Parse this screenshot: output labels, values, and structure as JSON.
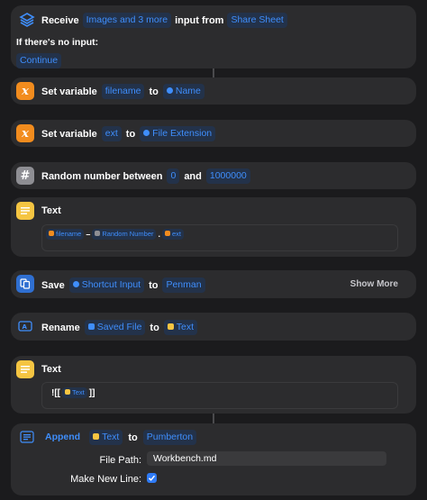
{
  "receive": {
    "label": "Receive",
    "types_token": "Images and 3 more",
    "mid_text": "input from",
    "source_token": "Share Sheet",
    "no_input_label": "If there's no input:",
    "continue_token": "Continue"
  },
  "set_var_1": {
    "label": "Set variable",
    "var_token": "filename",
    "to_text": "to",
    "value_token": "Name"
  },
  "set_var_2": {
    "label": "Set variable",
    "var_token": "ext",
    "to_text": "to",
    "value_token": "File Extension"
  },
  "random": {
    "label": "Random number between",
    "min_token": "0",
    "and_text": "and",
    "max_token": "1000000"
  },
  "text_1": {
    "label": "Text",
    "token_filename": "filename",
    "sep_dash": "–",
    "token_random": "Random Number",
    "sep_dot": ".",
    "token_ext": "ext"
  },
  "save": {
    "label": "Save",
    "input_token": "Shortcut Input",
    "to_text": "to",
    "dest_token": "Penman",
    "show_more": "Show More"
  },
  "rename": {
    "label": "Rename",
    "file_token": "Saved File",
    "to_text": "to",
    "text_token": "Text"
  },
  "text_2": {
    "label": "Text",
    "prefix": "![[",
    "token_text": "Text",
    "suffix": "]]"
  },
  "append": {
    "label": "Append",
    "text_token": "Text",
    "to_text": "to",
    "dest_token": "Pumberton",
    "file_path_label": "File Path:",
    "file_path_value": "Workbench.md",
    "new_line_label": "Make New Line:",
    "new_line_checked": true
  },
  "colors": {
    "background": "#1b1b1d",
    "card": "#2c2c2e",
    "token_text": "#3f8efc",
    "scripting_orange": "#f28c1e",
    "text_yellow": "#f5c542",
    "documents_blue": "#2f6fd1",
    "number_gray": "#8e8e93"
  },
  "icons": {
    "receive": "shortcuts-stack-icon",
    "set_variable": "variable-x-icon",
    "random": "hash-icon",
    "text": "text-lines-icon",
    "save": "documents-icon",
    "rename": "rename-icon",
    "append": "append-icon"
  }
}
